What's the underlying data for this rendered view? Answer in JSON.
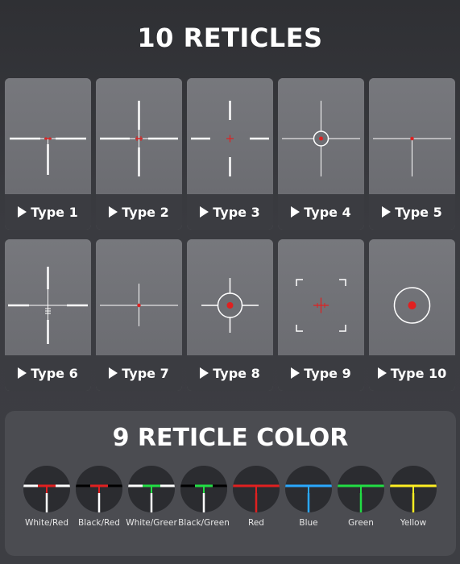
{
  "title": "10 RETICLES",
  "reticles": [
    {
      "label": "Type 1"
    },
    {
      "label": "Type 2"
    },
    {
      "label": "Type 3"
    },
    {
      "label": "Type 4"
    },
    {
      "label": "Type 5"
    },
    {
      "label": "Type 6"
    },
    {
      "label": "Type 7"
    },
    {
      "label": "Type 8"
    },
    {
      "label": "Type 9"
    },
    {
      "label": "Type 10"
    }
  ],
  "color_section": {
    "title": "9 RETICLE COLOR",
    "swatches": [
      {
        "name": "White/Red",
        "top": "#ffffff",
        "center": "#e02020",
        "bottom": "#ffffff"
      },
      {
        "name": "Black/Red",
        "top": "#000000",
        "center": "#e02020",
        "bottom": "#ffffff"
      },
      {
        "name": "White/Greer",
        "top": "#ffffff",
        "center": "#22dd44",
        "bottom": "#ffffff"
      },
      {
        "name": "Black/Green",
        "top": "#000000",
        "center": "#22dd44",
        "bottom": "#ffffff"
      },
      {
        "name": "Red",
        "top": "#e02020",
        "center": "#e02020",
        "bottom": "#e02020"
      },
      {
        "name": "Blue",
        "top": "#2aa8ff",
        "center": "#2aa8ff",
        "bottom": "#2aa8ff"
      },
      {
        "name": "Green",
        "top": "#22dd44",
        "center": "#22dd44",
        "bottom": "#22dd44"
      },
      {
        "name": "Yellow",
        "top": "#ffee22",
        "center": "#ffee22",
        "bottom": "#ffee22"
      }
    ]
  }
}
